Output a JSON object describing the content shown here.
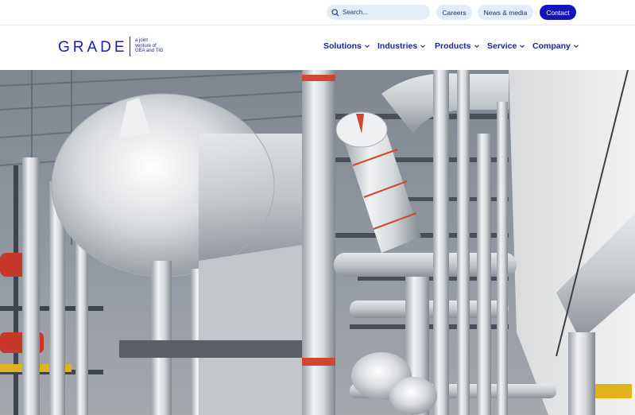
{
  "search": {
    "placeholder": "Search..."
  },
  "utility_links": {
    "careers": "Careers",
    "news": "News & media",
    "contact": "Contact"
  },
  "logo": {
    "wordmark": "GRADE",
    "tagline_1": "a joint",
    "tagline_2": "venture of",
    "tagline_3": "GEA and TIG"
  },
  "nav": {
    "solutions": "Solutions",
    "industries": "Industries",
    "products": "Products",
    "service": "Service",
    "company": "Company"
  },
  "colors": {
    "brand_blue": "#1a22a8",
    "contact_bg": "#1413b8",
    "pill_bg": "#e3ecf7"
  },
  "icons": {
    "search": "search-icon",
    "chevron": "chevron-down-icon"
  }
}
